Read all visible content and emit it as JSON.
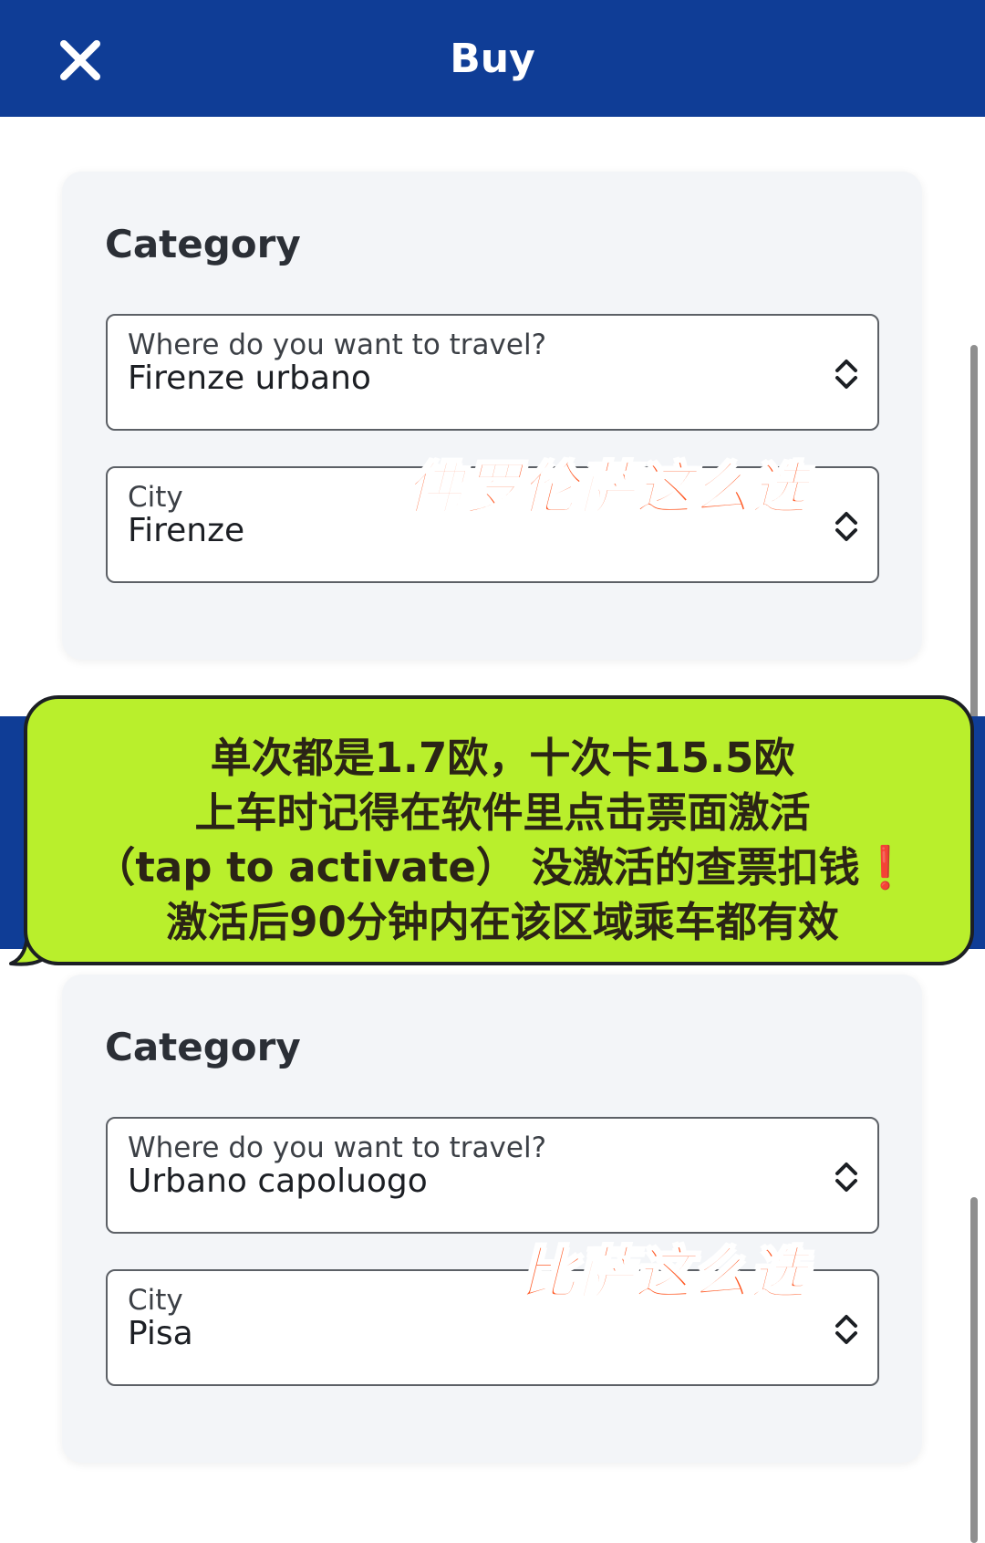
{
  "header": {
    "title": "Buy",
    "close_icon": "close-icon",
    "background_color": "#0f3d96"
  },
  "cards": [
    {
      "title": "Category",
      "travel_field": {
        "label": "Where do you want to travel?",
        "value": "Firenze urbano"
      },
      "city_field": {
        "label": "City",
        "value": "Firenze"
      },
      "annotation": "佛罗伦萨这么选"
    },
    {
      "title": "Category",
      "travel_field": {
        "label": "Where do you want to travel?",
        "value": "Urbano capoluogo"
      },
      "city_field": {
        "label": "City",
        "value": "Pisa"
      },
      "annotation": "比萨这么选"
    }
  ],
  "bubble": {
    "line1": "单次都是1.7欧，十次卡15.5欧",
    "line2": "上车时记得在软件里点击票面激活",
    "line3_text": "（tap  to  activate）  没激活的查票扣钱",
    "line3_mark": "❗",
    "line4": "激活后90分钟内在该区域乘车都有效",
    "fill_color": "#b9ef2c"
  },
  "colors": {
    "accent": "#0f3d96",
    "annotation": "#ff5722"
  }
}
